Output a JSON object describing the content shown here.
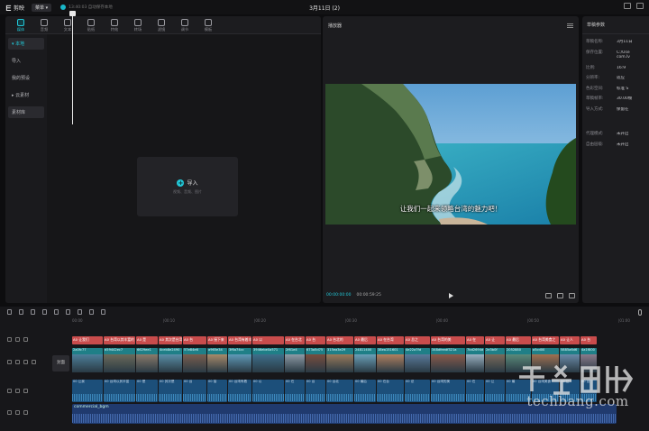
{
  "titlebar": {
    "app_name": "剪映",
    "menu_label": "菜单",
    "autosave": "13:40:03 自动保存本地",
    "project_title": "3月11日 (2)"
  },
  "toolbar": {
    "tools": [
      {
        "label": "媒体",
        "icon": "media-icon",
        "active": true
      },
      {
        "label": "音频",
        "icon": "audio-icon",
        "active": false
      },
      {
        "label": "文本",
        "icon": "text-icon",
        "active": false
      },
      {
        "label": "贴纸",
        "icon": "sticker-icon",
        "active": false
      },
      {
        "label": "特效",
        "icon": "effects-icon",
        "active": false
      },
      {
        "label": "转场",
        "icon": "transition-icon",
        "active": false
      },
      {
        "label": "滤镜",
        "icon": "filter-icon",
        "active": false
      },
      {
        "label": "调节",
        "icon": "adjust-icon",
        "active": false
      },
      {
        "label": "模板",
        "icon": "template-icon",
        "active": false
      }
    ]
  },
  "sidebar": {
    "items": [
      {
        "label": "▾ 本地",
        "active": true
      },
      {
        "label": "导入",
        "active": false
      },
      {
        "label": "我的预设",
        "active": false
      },
      {
        "label": "▸ 云素材",
        "active": false
      },
      {
        "label": "素材库",
        "active": false,
        "button": true
      }
    ]
  },
  "media": {
    "import_label": "导入",
    "import_hint": "视频、音频、图片"
  },
  "player": {
    "title": "播放器",
    "subtitle": "让我们一起来领略台湾的魅力吧！",
    "current_time": "00:00:00:00",
    "total_time": "00:00:59:25"
  },
  "props": {
    "title": "草稿参数",
    "rows": [
      {
        "key": "草稿名称:",
        "value": "3月11日"
      },
      {
        "key": "保存位置:",
        "value": "C:/Use\ncom.lv"
      },
      {
        "key": "比例:",
        "value": "16:9"
      },
      {
        "key": "分辨率:",
        "value": "适应"
      },
      {
        "key": "色彩空间:",
        "value": "标准 S"
      },
      {
        "key": "草稿帧率:",
        "value": "30.00帧"
      },
      {
        "key": "导入方式:",
        "value": "保留在"
      },
      {
        "key": "代理模式:",
        "value": "未开启"
      },
      {
        "key": "自由层级:",
        "value": "未开启"
      }
    ]
  },
  "timeline": {
    "ruler": [
      "00:00",
      "|00:10",
      "|00:20",
      "|00:30",
      "|00:40",
      "|00:50",
      "|01:00"
    ],
    "cover_label": "封面",
    "text_clips": [
      "A0 让我们",
      "A0 台湾以其丰富的",
      "A0 是",
      "A0 其次是台湾",
      "A0 台",
      "A0 接下来",
      "A0 台湾有着丰富",
      "A0 以",
      "A0 在台北",
      "A0 台",
      "A0 台北的",
      "A0 最后",
      "A0 在台湾",
      "A0 总之",
      "A0 台湾的美",
      "A0 在",
      "A0 让",
      "A0 最后",
      "A0 台湾美食之",
      "A0 让人",
      "A0 台"
    ],
    "video_clips": [
      "2a0fc77",
      "d59442ec7",
      "6629ee1",
      "4ceb8e2490",
      "57e84e6",
      "a965e34",
      "3f6a74cc",
      "3946ebe0a571",
      "2f61e4",
      "673a5d75",
      "315ea3e29",
      "24811400",
      "38ea151601",
      "4e22a7fd",
      "348dfeedf321a",
      "7bd2694d",
      "2e3b0f",
      "2052880",
      "a5cd00",
      "5885a6d6",
      "4a1f800"
    ],
    "audio_clips": [
      "00 让我",
      "00 台湾以其丰富",
      "00 是",
      "00 其次是",
      "00 台",
      "00 接",
      "00 台湾有着",
      "00 以",
      "00 在",
      "00 台",
      "00 台北",
      "00 最后",
      "00 在台",
      "00 总",
      "00 台湾的美",
      "00 在",
      "00 让",
      "00 最",
      "00 台湾美食",
      "00 让",
      "00 台"
    ],
    "bgm_label": "commercial_bgm"
  },
  "watermark": {
    "text": "techbang.com"
  },
  "colors": {
    "accent": "#22c8d8",
    "text_clip": "#c94c4c",
    "video_clip": "#1f7f87",
    "audio_clip": "#1c4f7a",
    "bgm_clip": "#203a6e"
  }
}
